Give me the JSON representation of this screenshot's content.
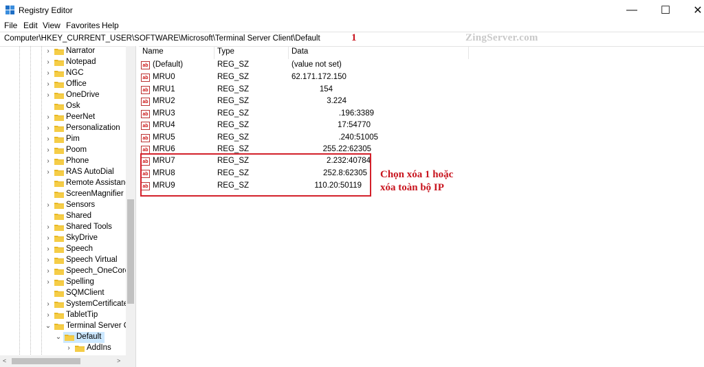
{
  "window": {
    "title": "Registry Editor",
    "minimize": "—",
    "maximize": "☐",
    "close": "✕"
  },
  "menu": [
    "File",
    "Edit",
    "View",
    "Favorites",
    "Help"
  ],
  "address": "Computer\\HKEY_CURRENT_USER\\SOFTWARE\\Microsoft\\Terminal Server Client\\Default",
  "annotations": {
    "step": "1",
    "watermark": "ZingServer.com",
    "note_line1": "Chọn xóa 1 hoặc",
    "note_line2": "xóa toàn bộ IP"
  },
  "tree": [
    {
      "label": "Narrator",
      "expander": "›"
    },
    {
      "label": "Notepad",
      "expander": "›"
    },
    {
      "label": "NGC",
      "expander": "›"
    },
    {
      "label": "Office",
      "expander": "›"
    },
    {
      "label": "OneDrive",
      "expander": "›"
    },
    {
      "label": "Osk",
      "expander": ""
    },
    {
      "label": "PeerNet",
      "expander": "›"
    },
    {
      "label": "Personalization",
      "expander": "›"
    },
    {
      "label": "Pim",
      "expander": "›"
    },
    {
      "label": "Poom",
      "expander": "›"
    },
    {
      "label": "Phone",
      "expander": "›"
    },
    {
      "label": "RAS AutoDial",
      "expander": "›"
    },
    {
      "label": "Remote Assistanc",
      "expander": ""
    },
    {
      "label": "ScreenMagnifier",
      "expander": ""
    },
    {
      "label": "Sensors",
      "expander": "›"
    },
    {
      "label": "Shared",
      "expander": ""
    },
    {
      "label": "Shared Tools",
      "expander": "›"
    },
    {
      "label": "SkyDrive",
      "expander": "›"
    },
    {
      "label": "Speech",
      "expander": "›"
    },
    {
      "label": "Speech Virtual",
      "expander": "›"
    },
    {
      "label": "Speech_OneCore",
      "expander": "›"
    },
    {
      "label": "Spelling",
      "expander": "›"
    },
    {
      "label": "SQMClient",
      "expander": ""
    },
    {
      "label": "SystemCertificates",
      "expander": "›"
    },
    {
      "label": "TabletTip",
      "expander": "›"
    },
    {
      "label": "Terminal Server Cl",
      "expander": "⌄"
    },
    {
      "label": "Default",
      "expander": "⌄"
    },
    {
      "label": "AddIns",
      "expander": "›"
    }
  ],
  "columns": {
    "name": "Name",
    "type": "Type",
    "data": "Data"
  },
  "values": [
    {
      "name": "(Default)",
      "type": "REG_SZ",
      "data": "(value not set)"
    },
    {
      "name": "MRU0",
      "type": "REG_SZ",
      "data": "62.171.172.150"
    },
    {
      "name": "MRU1",
      "type": "REG_SZ",
      "data": "154"
    },
    {
      "name": "MRU2",
      "type": "REG_SZ",
      "data": "3.224"
    },
    {
      "name": "MRU3",
      "type": "REG_SZ",
      "data": ".196:3389"
    },
    {
      "name": "MRU4",
      "type": "REG_SZ",
      "data": "17:54770"
    },
    {
      "name": "MRU5",
      "type": "REG_SZ",
      "data": ".240:51005"
    },
    {
      "name": "MRU6",
      "type": "REG_SZ",
      "data": "255.22:62305"
    },
    {
      "name": "MRU7",
      "type": "REG_SZ",
      "data": "2.232:40784"
    },
    {
      "name": "MRU8",
      "type": "REG_SZ",
      "data": "252.8:62305"
    },
    {
      "name": "MRU9",
      "type": "REG_SZ",
      "data": "110.20:50119"
    }
  ],
  "icons": {
    "app": "registry-editor-icon",
    "folder": "folder-icon",
    "value": "string-value-icon"
  },
  "colors": {
    "folder": "#e8b825",
    "annotation": "#c8141e",
    "selection": "#cce8ff"
  }
}
